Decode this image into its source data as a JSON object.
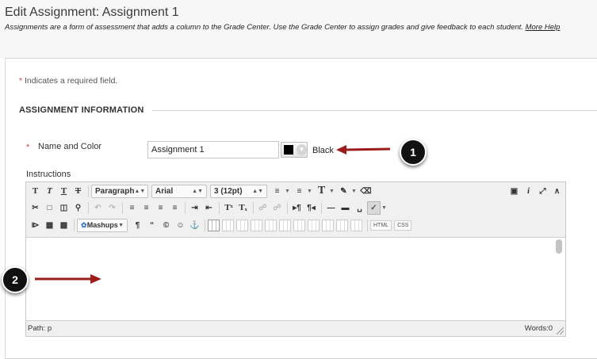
{
  "header": {
    "title": "Edit Assignment: Assignment 1",
    "description": "Assignments are a form of assessment that adds a column to the Grade Center. Use the Grade Center to assign grades and give feedback to each student.",
    "more_help": "More Help"
  },
  "form": {
    "required_star": "*",
    "required_note": "Indicates a required field.",
    "section_heading": "ASSIGNMENT INFORMATION",
    "name_label": "Name and Color",
    "name_value": "Assignment 1",
    "color_value": "#000000",
    "color_name": "Black",
    "instructions_label": "Instructions"
  },
  "editor": {
    "toolbar": {
      "format_block": "Paragraph",
      "font_family": "Arial",
      "font_size": "3 (12pt)",
      "mashups": "Mashups",
      "html_label": "HTML",
      "css_label": "CSS"
    },
    "status": {
      "path": "Path: p",
      "words": "Words:0"
    }
  },
  "callouts": [
    "1",
    "2"
  ],
  "colors": {
    "accent_arrow": "#9b1c1c",
    "required_star": "#cc4444",
    "callout_bg": "#111111"
  }
}
